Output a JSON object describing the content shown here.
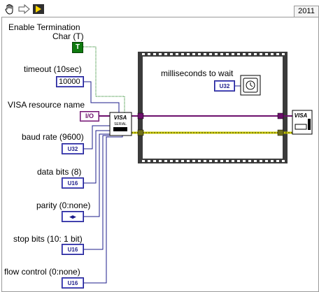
{
  "toolbar": {
    "hand_icon": "hand-icon",
    "arrow_icon": "arrow-right-icon",
    "run_icon": "highlight-execution-icon"
  },
  "year_tab": "2011",
  "inputs": {
    "enable_termination_label_1": "Enable Termination",
    "enable_termination_label_2": "Char (T)",
    "enable_termination_value": "T",
    "timeout_label": "timeout (10sec)",
    "timeout_value": "10000",
    "visa_resource_label": "VISA resource name",
    "visa_resource_value": "I/O",
    "baud_rate_label": "baud rate (9600)",
    "baud_rate_value": "U32",
    "data_bits_label": "data bits (8)",
    "data_bits_value": "U16",
    "parity_label": "parity (0:none)",
    "parity_value": "◂▸",
    "stop_bits_label": "stop bits (10: 1 bit)",
    "stop_bits_value": "U16",
    "flow_control_label": "flow control (0:none)",
    "flow_control_value": "U16"
  },
  "nodes": {
    "visa_config_top": "VISA",
    "visa_config_bottom": "SERIAL",
    "visa_close_top": "VISA"
  },
  "loop": {
    "ms_wait_label": "milliseconds to wait",
    "ms_wait_value": "U32"
  },
  "colors": {
    "bool_green": "#0f7a0f",
    "numeric_blue": "#1d1d8b",
    "visa_purple": "#6c0f6c",
    "error_yellow": "#c8c800",
    "error_olive": "#6f6f1a"
  }
}
